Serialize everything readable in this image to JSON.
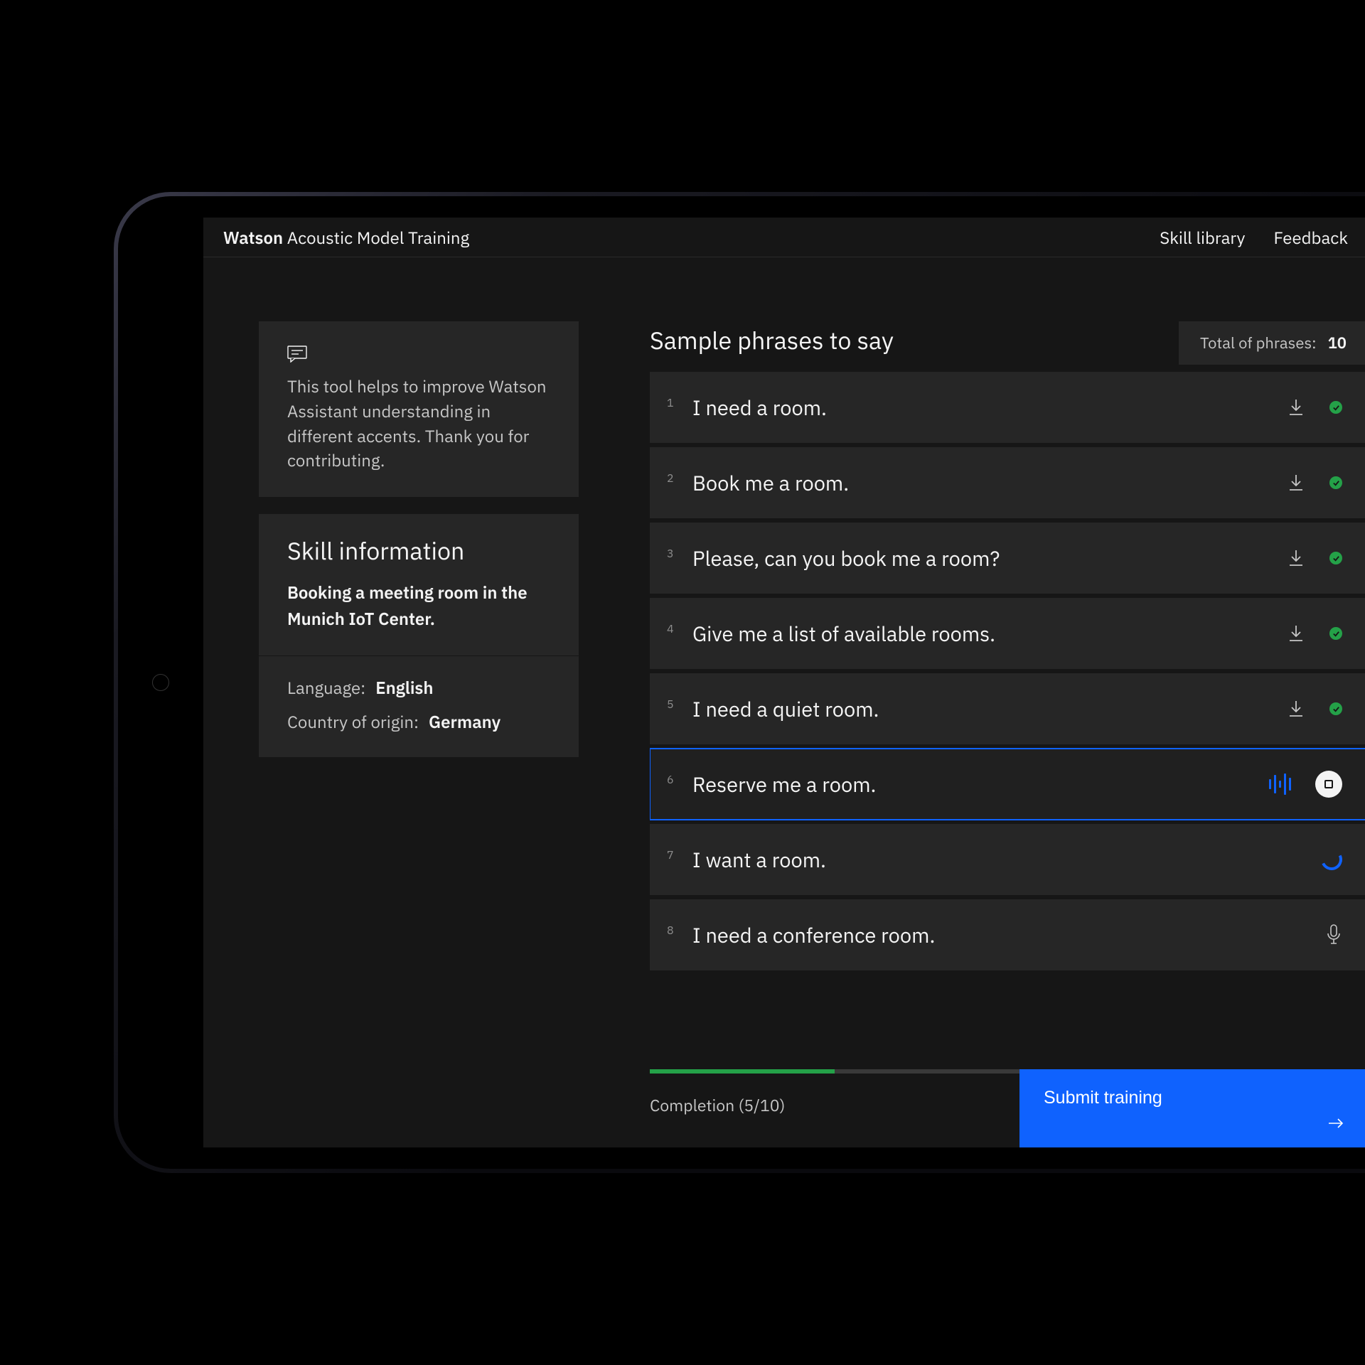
{
  "header": {
    "brand": "Watson",
    "app_name": "Acoustic Model Training",
    "links": {
      "skill_library": "Skill library",
      "feedback": "Feedback"
    }
  },
  "intro": {
    "text": "This tool helps to improve Watson Assistant understanding in different accents. Thank you for contributing."
  },
  "skill": {
    "section_title": "Skill information",
    "name": "Booking a meeting room in the Munich IoT Center.",
    "language_label": "Language:",
    "language_value": "English",
    "country_label": "Country of origin:",
    "country_value": "Germany"
  },
  "phrases": {
    "title": "Sample phrases to say",
    "total_label": "Total of phrases:",
    "total_value": "10",
    "items": [
      {
        "n": "1",
        "text": "I need a room.",
        "state": "done"
      },
      {
        "n": "2",
        "text": "Book me a room.",
        "state": "done"
      },
      {
        "n": "3",
        "text": "Please, can you book me a room?",
        "state": "done"
      },
      {
        "n": "4",
        "text": "Give me a list of available rooms.",
        "state": "done"
      },
      {
        "n": "5",
        "text": "I need a quiet room.",
        "state": "done"
      },
      {
        "n": "6",
        "text": "Reserve me a room.",
        "state": "recording"
      },
      {
        "n": "7",
        "text": "I want a room.",
        "state": "loading"
      },
      {
        "n": "8",
        "text": "I need a conference room.",
        "state": "idle"
      }
    ]
  },
  "footer": {
    "completion_label": "Completion (5/10)",
    "completed": 5,
    "total": 10,
    "submit_label": "Submit training"
  }
}
